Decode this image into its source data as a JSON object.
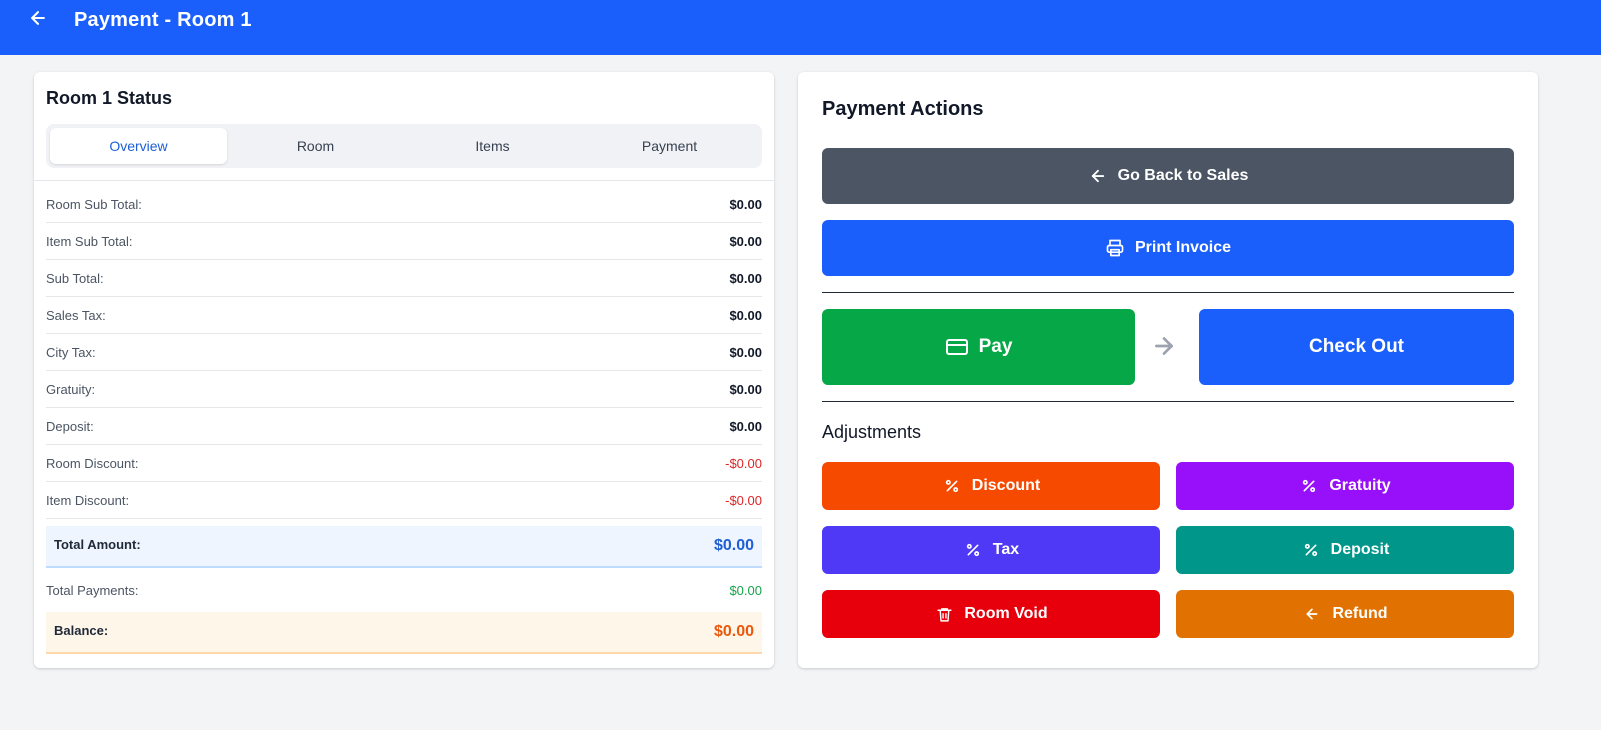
{
  "header": {
    "title": "Payment - Room 1",
    "background": "#1a5ffb"
  },
  "status": {
    "title": "Room 1 Status",
    "tabs": [
      {
        "label": "Overview",
        "active": true
      },
      {
        "label": "Room",
        "active": false
      },
      {
        "label": "Items",
        "active": false
      },
      {
        "label": "Payment",
        "active": false
      }
    ],
    "rows": [
      {
        "label": "Room Sub Total:",
        "value": "$0.00"
      },
      {
        "label": "Item Sub Total:",
        "value": "$0.00"
      },
      {
        "label": "Sub Total:",
        "value": "$0.00"
      },
      {
        "label": "Sales Tax:",
        "value": "$0.00"
      },
      {
        "label": "City Tax:",
        "value": "$0.00"
      },
      {
        "label": "Gratuity:",
        "value": "$0.00"
      },
      {
        "label": "Deposit:",
        "value": "$0.00"
      },
      {
        "label": "Room Discount:",
        "value": "-$0.00"
      },
      {
        "label": "Item Discount:",
        "value": "-$0.00"
      }
    ],
    "total": {
      "label": "Total Amount:",
      "value": "$0.00"
    },
    "payments": {
      "label": "Total Payments:",
      "value": "$0.00"
    },
    "balance": {
      "label": "Balance:",
      "value": "$0.00"
    }
  },
  "actions": {
    "title": "Payment Actions",
    "go_back_label": "Go Back to Sales",
    "print_label": "Print Invoice",
    "pay_label": "Pay",
    "checkout_label": "Check Out",
    "adjustments_title": "Adjustments",
    "discount_label": "Discount",
    "gratuity_label": "Gratuity",
    "tax_label": "Tax",
    "deposit_label": "Deposit",
    "room_void_label": "Room Void",
    "refund_label": "Refund"
  },
  "icons": {
    "header_back": "arrow-left-icon",
    "go_back": "arrow-left-icon",
    "print": "printer-icon",
    "pay": "credit-card-icon",
    "flow": "arrow-right-icon",
    "discount": "percent-icon",
    "gratuity": "percent-icon",
    "tax": "percent-icon",
    "deposit": "percent-icon",
    "room_void": "trash-icon",
    "refund": "arrow-left-icon"
  },
  "colors": {
    "go_back": "#4b5563",
    "print": "#1a5ffb",
    "pay": "#05a746",
    "checkout": "#1a5ffb",
    "discount": "#f54a00",
    "gratuity": "#9810fa",
    "tax": "#4f39f6",
    "deposit": "#009689",
    "room_void": "#e7000b",
    "refund": "#e17100"
  }
}
